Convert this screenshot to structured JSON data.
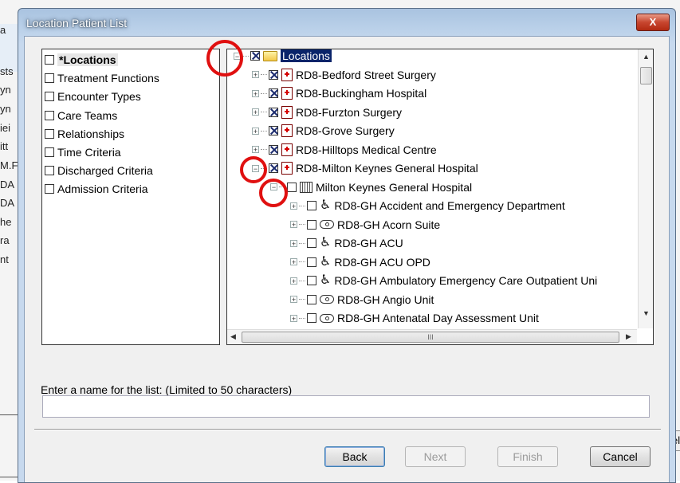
{
  "window": {
    "title": "Location Patient List",
    "close_label": "X"
  },
  "background": {
    "top_fragment": "a",
    "left_fragments": [
      "sts",
      "yn",
      "yn",
      "iei",
      "itt",
      "M.F",
      "DA",
      "DA",
      "he",
      "ra",
      "nt"
    ],
    "right_button_fragment": "el"
  },
  "criteria": {
    "items": [
      {
        "label": "*Locations",
        "checked": false,
        "selected": true
      },
      {
        "label": "Treatment Functions",
        "checked": false,
        "selected": false
      },
      {
        "label": "Encounter Types",
        "checked": false,
        "selected": false
      },
      {
        "label": "Care Teams",
        "checked": false,
        "selected": false
      },
      {
        "label": "Relationships",
        "checked": false,
        "selected": false
      },
      {
        "label": "Time Criteria",
        "checked": false,
        "selected": false
      },
      {
        "label": "Discharged Criteria",
        "checked": false,
        "selected": false
      },
      {
        "label": "Admission Criteria",
        "checked": false,
        "selected": false
      }
    ]
  },
  "tree": {
    "nodes": [
      {
        "label": "Locations",
        "level": 0,
        "expander": "minus",
        "checked": true,
        "icon": "folder-icon",
        "selected": true
      },
      {
        "label": "RD8-Bedford Street Surgery",
        "level": 1,
        "expander": "plus",
        "checked": true,
        "icon": "hospital-icon",
        "selected": false
      },
      {
        "label": "RD8-Buckingham Hospital",
        "level": 1,
        "expander": "plus",
        "checked": true,
        "icon": "hospital-icon",
        "selected": false
      },
      {
        "label": "RD8-Furzton Surgery",
        "level": 1,
        "expander": "plus",
        "checked": true,
        "icon": "hospital-icon",
        "selected": false
      },
      {
        "label": "RD8-Grove Surgery",
        "level": 1,
        "expander": "plus",
        "checked": true,
        "icon": "hospital-icon",
        "selected": false
      },
      {
        "label": "RD8-Hilltops Medical Centre",
        "level": 1,
        "expander": "plus",
        "checked": true,
        "icon": "hospital-icon",
        "selected": false
      },
      {
        "label": "RD8-Milton Keynes General Hospital",
        "level": 1,
        "expander": "minus",
        "checked": true,
        "icon": "hospital-icon",
        "selected": false
      },
      {
        "label": "Milton Keynes General Hospital",
        "level": 2,
        "expander": "minus",
        "checked": false,
        "icon": "building-icon",
        "selected": false
      },
      {
        "label": "RD8-GH Accident and Emergency Department",
        "level": 3,
        "expander": "plus",
        "checked": false,
        "icon": "wheelchair-icon",
        "selected": false
      },
      {
        "label": "RD8-GH Acorn Suite",
        "level": 3,
        "expander": "plus",
        "checked": false,
        "icon": "ward-icon",
        "selected": false
      },
      {
        "label": "RD8-GH ACU",
        "level": 3,
        "expander": "plus",
        "checked": false,
        "icon": "wheelchair-icon",
        "selected": false
      },
      {
        "label": "RD8-GH ACU OPD",
        "level": 3,
        "expander": "plus",
        "checked": false,
        "icon": "wheelchair-icon",
        "selected": false
      },
      {
        "label": "RD8-GH Ambulatory Emergency Care Outpatient Uni",
        "level": 3,
        "expander": "plus",
        "checked": false,
        "icon": "wheelchair-icon",
        "selected": false
      },
      {
        "label": "RD8-GH Angio Unit",
        "level": 3,
        "expander": "plus",
        "checked": false,
        "icon": "ward-icon",
        "selected": false
      },
      {
        "label": "RD8-GH Antenatal Day Assessment Unit",
        "level": 3,
        "expander": "plus",
        "checked": false,
        "icon": "ward-icon",
        "selected": false
      }
    ],
    "hscroll_grip": "III"
  },
  "name_field": {
    "label": "Enter a name for the list: (Limited to 50 characters)",
    "value": "",
    "placeholder": ""
  },
  "buttons": {
    "back": "Back",
    "next": "Next",
    "finish": "Finish",
    "cancel": "Cancel"
  },
  "colors": {
    "annotation_ring": "#e01010",
    "selection": "#0a246a",
    "close_button": "#c7462f"
  }
}
